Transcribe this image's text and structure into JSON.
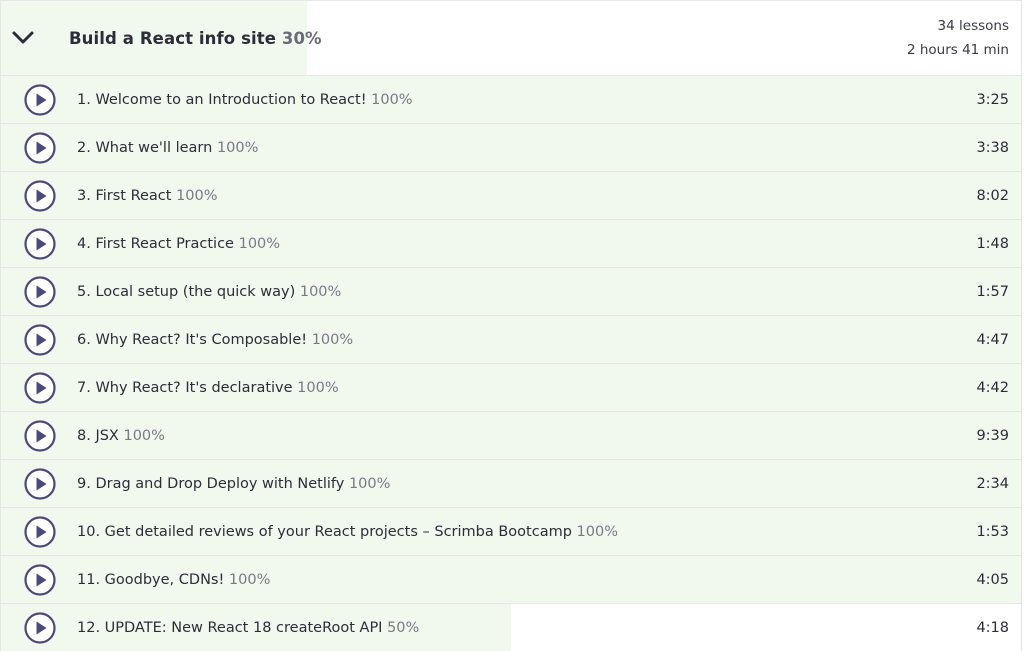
{
  "section": {
    "title": "Build a React info site",
    "progress_label": "30%",
    "progress": 0.3,
    "lessons_count": "34 lessons",
    "total_duration": "2 hours 41 min",
    "icon": "chevron-down-icon"
  },
  "colors": {
    "accent": "#4b4a7a",
    "progress_fill": "#f1f8ee",
    "divider": "#e6e6e6"
  },
  "lessons": [
    {
      "title": "1. Welcome to an Introduction to React!",
      "percent": "100%",
      "duration": "3:25",
      "progress": 1.0
    },
    {
      "title": "2. What we'll learn",
      "percent": "100%",
      "duration": "3:38",
      "progress": 1.0
    },
    {
      "title": "3. First React",
      "percent": "100%",
      "duration": "8:02",
      "progress": 1.0
    },
    {
      "title": "4. First React Practice",
      "percent": "100%",
      "duration": "1:48",
      "progress": 1.0
    },
    {
      "title": "5. Local setup (the quick way)",
      "percent": "100%",
      "duration": "1:57",
      "progress": 1.0
    },
    {
      "title": "6. Why React? It's Composable!",
      "percent": "100%",
      "duration": "4:47",
      "progress": 1.0
    },
    {
      "title": "7. Why React? It's declarative",
      "percent": "100%",
      "duration": "4:42",
      "progress": 1.0
    },
    {
      "title": "8. JSX",
      "percent": "100%",
      "duration": "9:39",
      "progress": 1.0
    },
    {
      "title": "9. Drag and Drop Deploy with Netlify",
      "percent": "100%",
      "duration": "2:34",
      "progress": 1.0
    },
    {
      "title": "10. Get detailed reviews of your React projects – Scrimba Bootcamp",
      "percent": "100%",
      "duration": "1:53",
      "progress": 1.0
    },
    {
      "title": "11. Goodbye, CDNs!",
      "percent": "100%",
      "duration": "4:05",
      "progress": 1.0
    },
    {
      "title": "12. UPDATE: New React 18 createRoot API",
      "percent": "50%",
      "duration": "4:18",
      "progress": 0.5
    }
  ]
}
